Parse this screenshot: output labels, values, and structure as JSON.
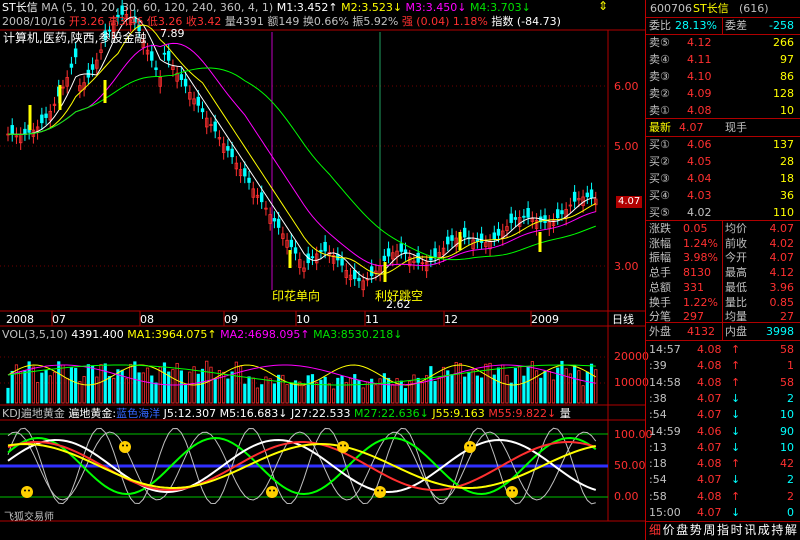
{
  "colors": {
    "up": "#ff3030",
    "down": "#00ffff",
    "border": "#b00000",
    "ma1": "#ffffff",
    "ma2": "#ffff00",
    "ma3": "#ff00ff",
    "ma4": "#00ff00"
  },
  "header": {
    "stock_name": "ST长信",
    "ma_params": "MA (5, 10, 20, 30, 60, 120, 240, 360, 4, 1)",
    "m1": "M1:3.452",
    "m2": "M2:3.523",
    "m3": "M3:3.450",
    "m4": "M4:3.703",
    "date": "2008/10/16",
    "open": "开3.26",
    "high": "高3.46",
    "low": "低3.26",
    "close": "收3.42",
    "volume": "量4391",
    "amount": "额149",
    "turnover": "换0.66%",
    "amplitude": "振5.92%",
    "strength": "强 (0.04) 1.18%",
    "index_label": "指数 (-84.73)"
  },
  "sector_tags": "计算机,医药,陕西,参股金融",
  "annotations": {
    "high_label": "7.89",
    "low_label": "2.62",
    "event1": "印花单向",
    "event2": "利好跳空"
  },
  "price_axis": [
    "6.00",
    "5.00",
    "4.07",
    "3.00"
  ],
  "date_axis": [
    "2008",
    "07",
    "08",
    "09",
    "10",
    "11",
    "12",
    "2009"
  ],
  "period_label": "日线",
  "volume_header": {
    "title": "VOL(3,5,10)",
    "value": "4391.400",
    "ma1": "MA1:3964.075",
    "ma2": "MA2:4698.095",
    "ma3": "MA3:8530.218"
  },
  "volume_axis": [
    "20000",
    "10000"
  ],
  "kdj_header": {
    "title": "KDJ遍地黄金",
    "name": "遍地黄金:",
    "sub": "蓝色海洋",
    "j5": "J5:12.307",
    "m5": "M5:16.683",
    "j27": "J27:22.533",
    "m27": "M27:22.636",
    "j55": "J55:9.163",
    "m55": "M55:9.822",
    "tail": "量"
  },
  "kdj_axis": [
    "100.00",
    "50.00",
    "0.00"
  ],
  "watermark": "飞狐交易师",
  "quote": {
    "code": "600706",
    "name": "ST长信",
    "code_suffix": "(616)",
    "weibi_label": "委比",
    "weibi": "28.13%",
    "weicha_label": "委差",
    "weicha": "-258",
    "sells": [
      {
        "label": "卖⑤",
        "price": "4.12",
        "vol": "266"
      },
      {
        "label": "卖④",
        "price": "4.11",
        "vol": "97"
      },
      {
        "label": "卖③",
        "price": "4.10",
        "vol": "86"
      },
      {
        "label": "卖②",
        "price": "4.09",
        "vol": "128"
      },
      {
        "label": "卖①",
        "price": "4.08",
        "vol": "10"
      }
    ],
    "last_label": "最新",
    "last": "4.07",
    "now_label": "现手",
    "buys": [
      {
        "label": "买①",
        "price": "4.06",
        "vol": "137"
      },
      {
        "label": "买②",
        "price": "4.05",
        "vol": "28"
      },
      {
        "label": "买③",
        "price": "4.04",
        "vol": "18"
      },
      {
        "label": "买④",
        "price": "4.03",
        "vol": "36"
      },
      {
        "label": "买⑤",
        "price": "4.02",
        "vol": "110"
      }
    ],
    "stats": [
      {
        "l1": "涨跌",
        "v1": "0.05",
        "l2": "均价",
        "v2": "4.07"
      },
      {
        "l1": "涨幅",
        "v1": "1.24%",
        "l2": "前收",
        "v2": "4.02"
      },
      {
        "l1": "振幅",
        "v1": "3.98%",
        "l2": "今开",
        "v2": "4.07"
      },
      {
        "l1": "总手",
        "v1": "8130",
        "l2": "最高",
        "v2": "4.12"
      },
      {
        "l1": "总额",
        "v1": "331",
        "l2": "最低",
        "v2": "3.96"
      },
      {
        "l1": "换手",
        "v1": "1.22%",
        "l2": "量比",
        "v2": "0.85"
      },
      {
        "l1": "分笔",
        "v1": "297",
        "l2": "均量",
        "v2": "27"
      }
    ],
    "waipan_label": "外盘",
    "waipan": "4132",
    "neipan_label": "内盘",
    "neipan": "3998"
  },
  "ticks": [
    {
      "time": "14:57",
      "price": "4.08",
      "arrow": "↑",
      "vol": "58"
    },
    {
      "time": ":39",
      "price": "4.08",
      "arrow": "↑",
      "vol": "1"
    },
    {
      "time": "14:58",
      "price": "4.08",
      "arrow": "↑",
      "vol": "58"
    },
    {
      "time": ":38",
      "price": "4.07",
      "arrow": "↓",
      "vol": "2"
    },
    {
      "time": ":54",
      "price": "4.07",
      "arrow": "↓",
      "vol": "10"
    },
    {
      "time": "14:59",
      "price": "4.06",
      "arrow": "↓",
      "vol": "90"
    },
    {
      "time": ":13",
      "price": "4.07",
      "arrow": "↓",
      "vol": "10"
    },
    {
      "time": ":18",
      "price": "4.08",
      "arrow": "↑",
      "vol": "42"
    },
    {
      "time": ":54",
      "price": "4.07",
      "arrow": "↓",
      "vol": "2"
    },
    {
      "time": ":58",
      "price": "4.08",
      "arrow": "↑",
      "vol": "2"
    },
    {
      "time": "15:00",
      "price": "4.07",
      "arrow": "↓",
      "vol": "0"
    }
  ],
  "bottom_tabs": [
    "细",
    "价",
    "盘",
    "势",
    "周",
    "指",
    "时",
    "讯",
    "成",
    "持",
    "解"
  ]
}
